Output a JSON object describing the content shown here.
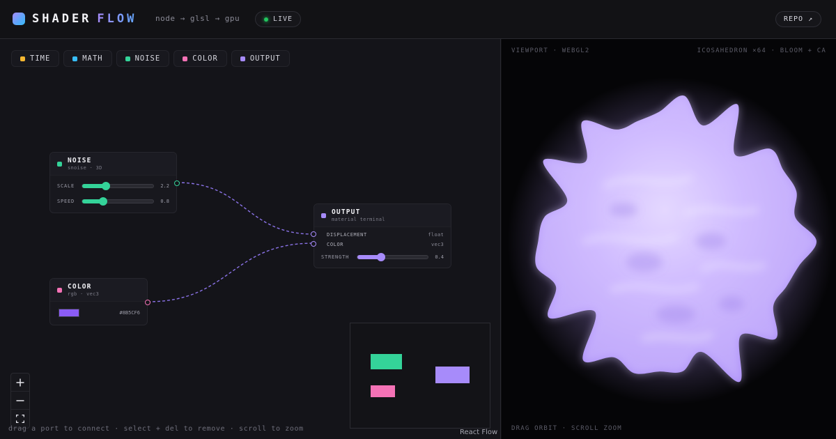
{
  "header": {
    "brand_primary": "SHADER",
    "brand_accent": "FLOW",
    "tagline": "node → glsl → gpu",
    "live_label": "LIVE",
    "repo_label": "REPO ↗"
  },
  "palette": [
    {
      "label": "TIME",
      "color": "#f5b731"
    },
    {
      "label": "MATH",
      "color": "#38bdf8"
    },
    {
      "label": "NOISE",
      "color": "#34d399"
    },
    {
      "label": "COLOR",
      "color": "#f472b6"
    },
    {
      "label": "OUTPUT",
      "color": "#a78bfa"
    }
  ],
  "nodes": {
    "noise": {
      "title": "NOISE",
      "subtitle": "snoise · 3D",
      "color": "#34d399",
      "params": [
        {
          "label": "SCALE",
          "value": "2.2",
          "fraction": 0.33
        },
        {
          "label": "SPEED",
          "value": "0.8",
          "fraction": 0.29
        }
      ]
    },
    "color": {
      "title": "COLOR",
      "subtitle": "rgb · vec3",
      "color": "#f472b6",
      "swatch": "#8B5CF6",
      "hex": "#8B5CF6"
    },
    "output": {
      "title": "OUTPUT",
      "subtitle": "material terminal",
      "color": "#a78bfa",
      "inputs": [
        {
          "label": "DISPLACEMENT",
          "type": "float"
        },
        {
          "label": "COLOR",
          "type": "vec3"
        }
      ],
      "strength": {
        "label": "STRENGTH",
        "value": "0.4",
        "fraction": 0.34
      }
    }
  },
  "hint": "drag a port to connect · select + del to remove · scroll to zoom",
  "attribution": "React Flow",
  "viewport": {
    "top_left": "VIEWPORT · WEBGL2",
    "top_right": "ICOSAHEDRON ×64 · BLOOM + CA",
    "bottom_left": "DRAG ORBIT · SCROLL ZOOM"
  },
  "icons": {
    "zoom_in": "plus-icon",
    "zoom_out": "minus-icon",
    "fit": "fit-view-icon"
  }
}
